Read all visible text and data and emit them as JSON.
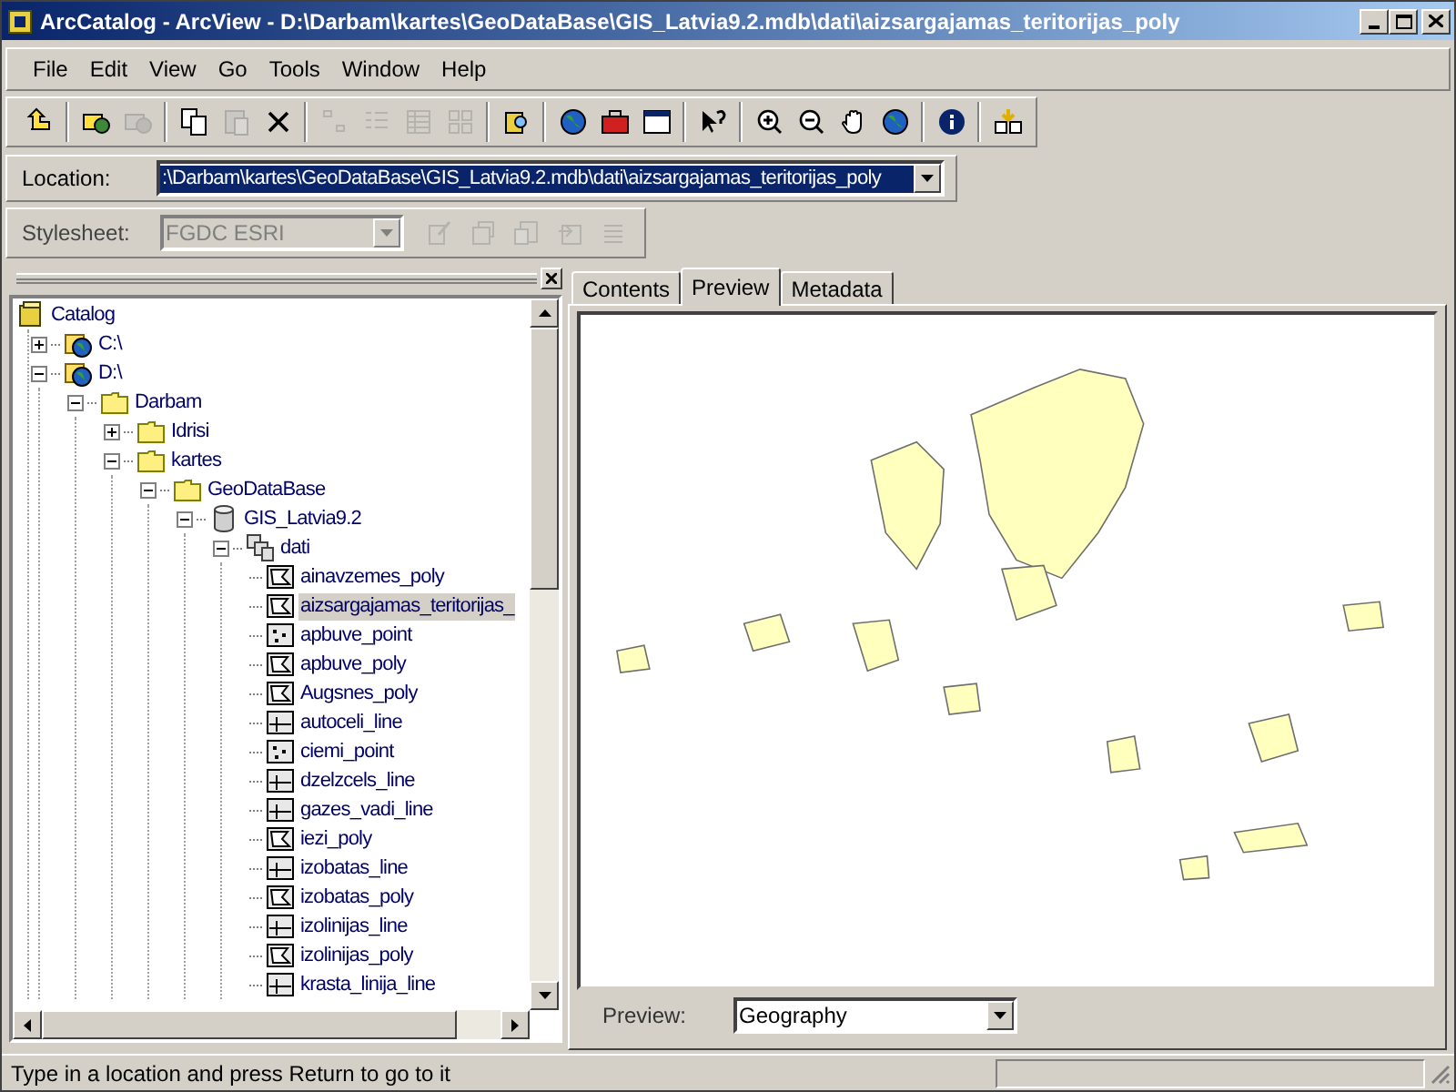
{
  "window": {
    "title": "ArcCatalog - ArcView - D:\\Darbam\\kartes\\GeoDataBase\\GIS_Latvia9.2.mdb\\dati\\aizsargajamas_teritorijas_poly"
  },
  "menu": [
    "File",
    "Edit",
    "View",
    "Go",
    "Tools",
    "Window",
    "Help"
  ],
  "toolbar": [
    [
      {
        "kind": "up",
        "disabled": false
      }
    ],
    [
      {
        "kind": "connect",
        "disabled": false
      },
      {
        "kind": "disconnect",
        "disabled": true
      }
    ],
    [
      {
        "kind": "copy",
        "disabled": false
      },
      {
        "kind": "paste",
        "disabled": true
      },
      {
        "kind": "delete",
        "disabled": false
      }
    ],
    [
      {
        "kind": "large-icons",
        "disabled": true
      },
      {
        "kind": "list",
        "disabled": true
      },
      {
        "kind": "details",
        "disabled": true
      },
      {
        "kind": "thumbnails",
        "disabled": true
      }
    ],
    [
      {
        "kind": "search",
        "disabled": false
      }
    ],
    [
      {
        "kind": "globe",
        "disabled": false
      },
      {
        "kind": "toolbox",
        "disabled": false
      },
      {
        "kind": "command",
        "disabled": false
      }
    ],
    [
      {
        "kind": "help",
        "disabled": false
      }
    ],
    [
      {
        "kind": "zoom-in",
        "disabled": false
      },
      {
        "kind": "zoom-out",
        "disabled": false
      },
      {
        "kind": "pan",
        "disabled": false
      },
      {
        "kind": "globe",
        "disabled": false
      }
    ],
    [
      {
        "kind": "info",
        "disabled": false
      }
    ],
    [
      {
        "kind": "thumbnail",
        "disabled": false
      }
    ]
  ],
  "location": {
    "label": "Location:",
    "value": ":\\Darbam\\kartes\\GeoDataBase\\GIS_Latvia9.2.mdb\\dati\\aizsargajamas_teritorijas_poly"
  },
  "stylesheet": {
    "label": "Stylesheet:",
    "value": "FGDC ESRI",
    "disabled": true,
    "tools": [
      {
        "kind": "edit",
        "disabled": true
      },
      {
        "kind": "properties",
        "disabled": true
      },
      {
        "kind": "import",
        "disabled": true
      },
      {
        "kind": "export",
        "disabled": true
      },
      {
        "kind": "validate",
        "disabled": true
      }
    ]
  },
  "tree": [
    {
      "label": "Catalog",
      "kind": "catalog",
      "selected": false,
      "children": [
        {
          "label": "C:\\",
          "kind": "drive",
          "selected": false,
          "expanded": false
        },
        {
          "label": "D:\\",
          "kind": "drive",
          "selected": false,
          "expanded": true,
          "children": [
            {
              "label": "Darbam",
              "kind": "folder",
              "selected": false,
              "expanded": true,
              "children": [
                {
                  "label": "Idrisi",
                  "kind": "folder",
                  "selected": false,
                  "expanded": false
                },
                {
                  "label": "kartes",
                  "kind": "folder",
                  "selected": false,
                  "expanded": true,
                  "children": [
                    {
                      "label": "GeoDataBase",
                      "kind": "folder",
                      "selected": false,
                      "expanded": true,
                      "children": [
                        {
                          "label": "GIS_Latvia9.2",
                          "kind": "database",
                          "selected": false,
                          "expanded": true,
                          "children": [
                            {
                              "label": "dati",
                              "kind": "dataset",
                              "selected": false,
                              "expanded": true,
                              "children": [
                                {
                                  "label": "ainavzemes_poly",
                                  "kind": "polygon",
                                  "selected": false
                                },
                                {
                                  "label": "aizsargajamas_teritorijas_",
                                  "kind": "polygon",
                                  "selected": true
                                },
                                {
                                  "label": "apbuve_point",
                                  "kind": "point",
                                  "selected": false
                                },
                                {
                                  "label": "apbuve_poly",
                                  "kind": "polygon",
                                  "selected": false
                                },
                                {
                                  "label": "Augsnes_poly",
                                  "kind": "polygon",
                                  "selected": false
                                },
                                {
                                  "label": "autoceli_line",
                                  "kind": "line",
                                  "selected": false
                                },
                                {
                                  "label": "ciemi_point",
                                  "kind": "point",
                                  "selected": false
                                },
                                {
                                  "label": "dzelzcels_line",
                                  "kind": "line",
                                  "selected": false
                                },
                                {
                                  "label": "gazes_vadi_line",
                                  "kind": "line",
                                  "selected": false
                                },
                                {
                                  "label": "iezi_poly",
                                  "kind": "polygon",
                                  "selected": false
                                },
                                {
                                  "label": "izobatas_line",
                                  "kind": "line",
                                  "selected": false
                                },
                                {
                                  "label": "izobatas_poly",
                                  "kind": "polygon",
                                  "selected": false
                                },
                                {
                                  "label": "izolinijas_line",
                                  "kind": "line",
                                  "selected": false
                                },
                                {
                                  "label": "izolinijas_poly",
                                  "kind": "polygon",
                                  "selected": false
                                },
                                {
                                  "label": "krasta_linija_line",
                                  "kind": "line",
                                  "selected": false
                                }
                              ]
                            }
                          ]
                        }
                      ]
                    }
                  ]
                }
              ]
            }
          ]
        }
      ]
    }
  ],
  "tabs": [
    {
      "label": "Contents",
      "selected": false
    },
    {
      "label": "Preview",
      "selected": true
    },
    {
      "label": "Metadata",
      "selected": false
    }
  ],
  "preview": {
    "label": "Preview:",
    "value": "Geography"
  },
  "status_bar": {
    "text": "Type in a location and press Return to go to it"
  }
}
